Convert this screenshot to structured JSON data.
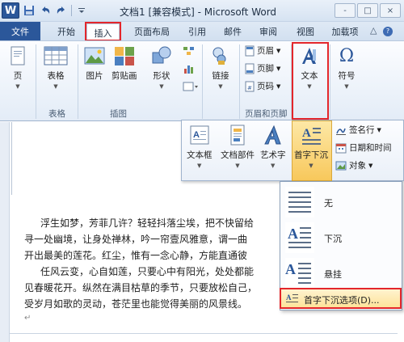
{
  "window": {
    "title": "文档1 [兼容模式] - Microsoft Word",
    "app_icon_letter": "W",
    "controls": [
      "-",
      "□",
      "×"
    ]
  },
  "qat": {
    "icons": [
      "save-icon",
      "undo-icon",
      "redo-icon",
      "customize-icon"
    ]
  },
  "tabs": [
    {
      "label": "文件"
    },
    {
      "label": "开始"
    },
    {
      "label": "插入"
    },
    {
      "label": "页面布局"
    },
    {
      "label": "引用"
    },
    {
      "label": "邮件"
    },
    {
      "label": "审阅"
    },
    {
      "label": "视图"
    },
    {
      "label": "加载项"
    }
  ],
  "ribbon": {
    "page": "页",
    "table": "表格",
    "picture": "图片",
    "clipart": "剪贴画",
    "shapes": "形状",
    "link": "链接",
    "header": "页眉",
    "footer": "页脚",
    "pagenum": "页码",
    "text": "文本",
    "symbol": "符号",
    "symbol_glyph": "Ω",
    "groups": {
      "tables": "表格",
      "illustrations": "插图",
      "header_footer": "页眉和页脚"
    }
  },
  "text_panel": {
    "textbox": "文本框",
    "quickparts": "文档部件",
    "wordart": "艺术字",
    "dropcap": "首字下沉",
    "signature": "签名行",
    "datetime": "日期和时间",
    "object": "对象"
  },
  "dropcap_menu": {
    "none": "无",
    "dropped": "下沉",
    "margin": "悬挂",
    "options": "首字下沉选项(D)..."
  },
  "document": {
    "lines": [
      "浮生如梦，芳菲几许？轻轻抖落尘埃，把不快留给",
      "寻一处幽境，让身处禅林，吟一帘壹风雅意，谓一曲",
      "开出最美的莲花。红尘，惟有一念心静，方能直通彼",
      "任风云变，心自如莲，只要心中有阳光，处处都能",
      "见春暖花开。纵然在满目枯草的季节，只要放松自己，",
      "受岁月如歌的灵动，苍茫里也能觉得美丽的风景线。"
    ],
    "end_mark": "↵"
  }
}
